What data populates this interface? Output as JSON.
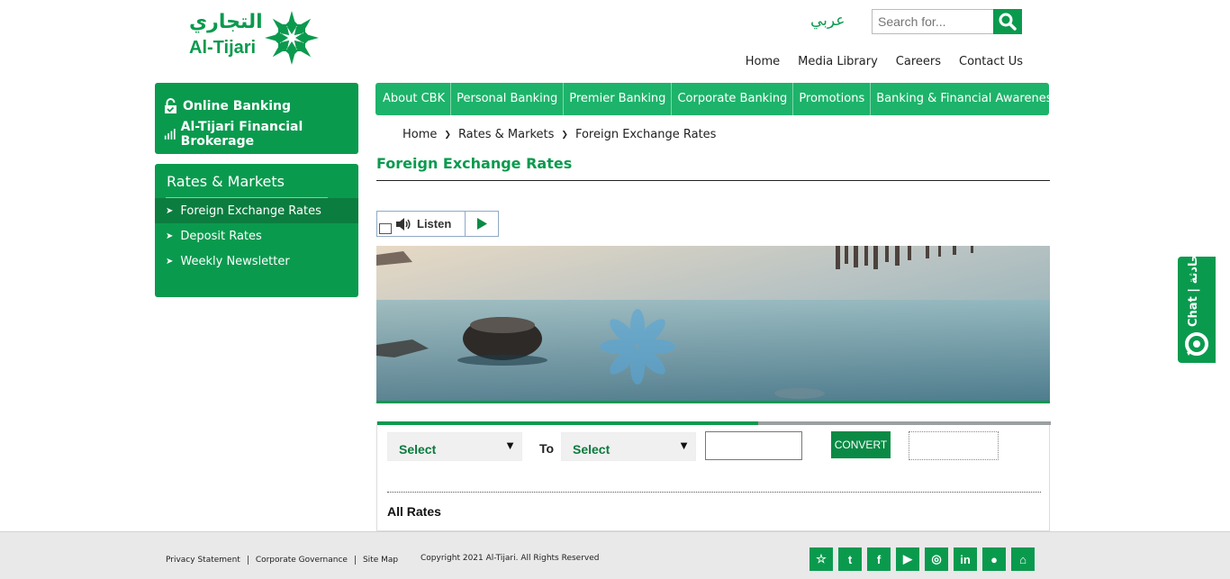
{
  "header": {
    "logo_ar": "التجاري",
    "logo_en": "Al-Tijari",
    "lang_link": "عربي",
    "search_placeholder": "Search for...",
    "top_links": [
      "Home",
      "Media Library",
      "Careers",
      "Contact Us"
    ]
  },
  "sidebar": {
    "online": [
      {
        "label": "Online Banking",
        "icon": "lock-icon"
      },
      {
        "label": "Al-Tijari Financial Brokerage",
        "icon": "bar-chart-icon"
      }
    ],
    "section_title": "Rates & Markets",
    "items": [
      {
        "label": "Foreign Exchange Rates",
        "active": true
      },
      {
        "label": "Deposit Rates",
        "active": false
      },
      {
        "label": "Weekly Newsletter",
        "active": false
      }
    ]
  },
  "nav": {
    "items": [
      "About CBK",
      "Personal Banking",
      "Premier Banking",
      "Corporate Banking",
      "Promotions",
      "Banking & Financial Awareness"
    ]
  },
  "breadcrumb": [
    "Home",
    "Rates & Markets",
    "Foreign Exchange Rates"
  ],
  "page_title": "Foreign Exchange Rates",
  "listen": {
    "label": "Listen"
  },
  "converter": {
    "from_value": "Select",
    "to_label": "To",
    "to_value": "Select",
    "convert_label": "CONVERT",
    "all_rates_label": "All Rates",
    "progress": 0.565
  },
  "chat": {
    "label": "Chat | محادثة"
  },
  "footer": {
    "links": [
      "Privacy Statement",
      "Corporate Governance",
      "Site Map"
    ],
    "copyright": "Copyright 2021 Al-Tijari. All Rights Reserved",
    "socials": [
      {
        "icon": "snapchat-icon",
        "glyph": "☆"
      },
      {
        "icon": "twitter-icon",
        "glyph": "t"
      },
      {
        "icon": "facebook-icon",
        "glyph": "f"
      },
      {
        "icon": "youtube-icon",
        "glyph": "▶"
      },
      {
        "icon": "instagram-icon",
        "glyph": "◎"
      },
      {
        "icon": "linkedin-icon",
        "glyph": "in"
      },
      {
        "icon": "apple-icon",
        "glyph": "●"
      },
      {
        "icon": "android-icon",
        "glyph": "⌂"
      }
    ]
  },
  "colors": {
    "brand": "#0a9a4e",
    "nav": "#1db36a",
    "active": "#0b7d3f"
  }
}
